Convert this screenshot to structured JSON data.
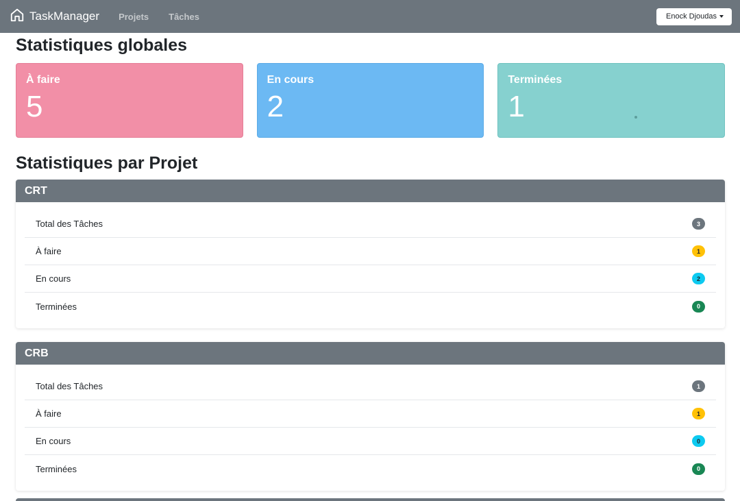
{
  "navbar": {
    "brand": "TaskManager",
    "brand_icon": "house-icon",
    "links": [
      "Projets",
      "Tâches"
    ],
    "user": "Enock Djoudas"
  },
  "global_stats": {
    "title": "Statistiques globales",
    "cards": [
      {
        "label": "À faire",
        "value": "5",
        "color": "#f28fa7"
      },
      {
        "label": "En cours",
        "value": "2",
        "color": "#6cb9f3"
      },
      {
        "label": "Terminées",
        "value": "1",
        "color": "#86d1cf"
      }
    ]
  },
  "project_stats": {
    "title": "Statistiques par Projet",
    "projects": [
      {
        "name": "CRT",
        "rows": [
          {
            "label": "Total des Tâches",
            "value": "3"
          },
          {
            "label": "À faire",
            "value": "1"
          },
          {
            "label": "En cours",
            "value": "2"
          },
          {
            "label": "Terminées",
            "value": "0"
          }
        ]
      },
      {
        "name": "CRB",
        "rows": [
          {
            "label": "Total des Tâches",
            "value": "1"
          },
          {
            "label": "À faire",
            "value": "1"
          },
          {
            "label": "En cours",
            "value": "0"
          },
          {
            "label": "Terminées",
            "value": "0"
          }
        ]
      }
    ]
  },
  "colors": {
    "navbar": "#6c757d",
    "badge_total": "#6c757d",
    "badge_todo": "#ffc107",
    "badge_progress": "#0dcaf0",
    "badge_done": "#198754"
  }
}
